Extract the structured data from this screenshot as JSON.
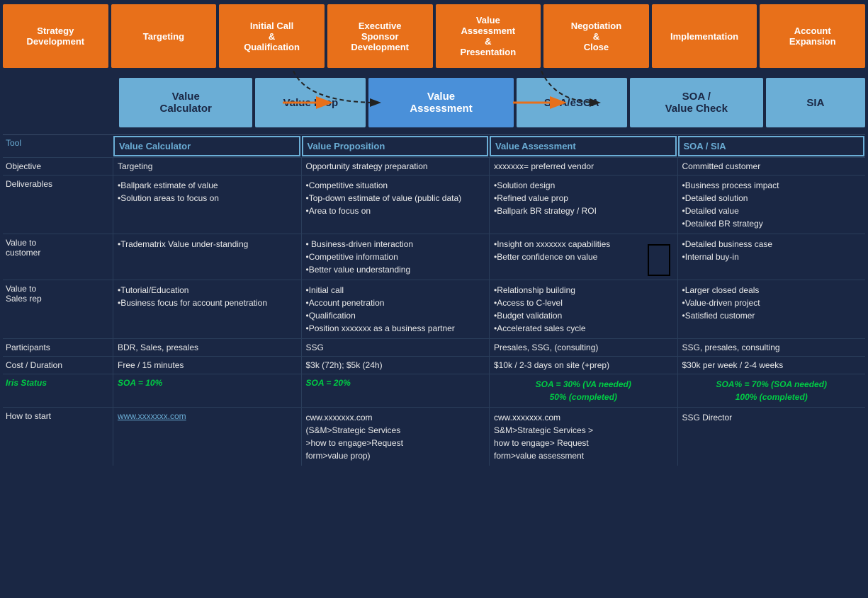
{
  "stages": [
    {
      "id": "strategy",
      "label": "Strategy\nDevelopment"
    },
    {
      "id": "targeting",
      "label": "Targeting"
    },
    {
      "id": "initial-call",
      "label": "Initial Call\n&\nQualification"
    },
    {
      "id": "exec-sponsor",
      "label": "Executive\nSponsor\nDevelopment"
    },
    {
      "id": "value-assess",
      "label": "Value\nAssessment\n&\nPresentation"
    },
    {
      "id": "negotiation",
      "label": "Negotiation\n&\nClose"
    },
    {
      "id": "implementation",
      "label": "Implementation"
    },
    {
      "id": "account-exp",
      "label": "Account\nExpansion"
    }
  ],
  "tools": [
    {
      "id": "value-calc",
      "label": "Value\nCalculator"
    },
    {
      "id": "value-prop",
      "label": "Value Prop"
    },
    {
      "id": "value-assessment",
      "label": "Value\nAssessment"
    },
    {
      "id": "soa-esoa",
      "label": "SOA/eSOA"
    },
    {
      "id": "soa-value-check",
      "label": "SOA /\nValue Check"
    },
    {
      "id": "sia",
      "label": "SIA"
    }
  ],
  "tool_label": "Tool",
  "rows": [
    {
      "id": "tool-header",
      "label": "Tool",
      "label_class": "tool-label",
      "cells": [
        "Value Calculator",
        "Value Proposition",
        "Value Assessment",
        "SOA / SIA"
      ]
    },
    {
      "id": "objective",
      "label": "Objective",
      "cells": [
        "Targeting",
        "Opportunity strategy preparation",
        "xxxxxxx= preferred vendor",
        "Committed customer"
      ]
    },
    {
      "id": "deliverables",
      "label": "Deliverables",
      "cells": [
        "•Ballpark estimate of value\n•Solution areas to focus on",
        "•Competitive situation\n•Top-down estimate of value (public data)\n•Area to focus on",
        "•Solution design\n•Refined value prop\n•Ballpark BR strategy / ROI",
        "•Business process impact\n•Detailed solution\n•Detailed value\n•Detailed BR strategy"
      ]
    },
    {
      "id": "value-customer",
      "label": "Value to\n customer",
      "cells": [
        "•Tradematrix Value under-standing",
        "• Business-driven interaction\n•Competitive information\n•Better value understanding",
        "•Insight on xxxxxxx capabilities\n•Better confidence on value",
        "•Detailed business case\n•Internal buy-in"
      ]
    },
    {
      "id": "value-salesrep",
      "label": "Value to\nSales rep",
      "cells": [
        "•Tutorial/Education\n•Business focus for account penetration",
        "•Initial call\n•Account penetration\n•Qualification\n•Position xxxxxxx as a business partner",
        "•Relationship building\n•Access to C-level\n•Budget validation\n•Accelerated sales cycle",
        "•Larger closed deals\n•Value-driven project\n•Satisfied customer"
      ]
    },
    {
      "id": "participants",
      "label": "Participants",
      "cells": [
        "BDR, Sales, presales",
        "SSG",
        "Presales, SSG, (consulting)",
        "SSG, presales, consulting"
      ]
    },
    {
      "id": "cost-duration",
      "label": "Cost / Duration",
      "cells": [
        "Free / 15 minutes",
        "$3k (72h);  $5k (24h)",
        "$10k / 2-3 days on site (+prep)",
        "$30k per week / 2-4 weeks"
      ]
    },
    {
      "id": "iris-status",
      "label": "Iris Status",
      "label_class": "iris",
      "cells": [
        "SOA = 10%",
        "SOA = 20%",
        "SOA = 30% (VA needed)\n50% (completed)",
        "SOA% = 70% (SOA needed)\n100% (completed)"
      ],
      "cells_class": "iris"
    },
    {
      "id": "how-to-start",
      "label": "How to start",
      "cells": [
        "www.xxxxxxx.com",
        "cww.xxxxxxx.com\n(S&M>Strategic Services\n>how to engage>Request\nform>value prop)",
        "cww.xxxxxxx.com\nS&M>Strategic Services >\nhow to engage> Request\nform>value assessment",
        "SSG Director"
      ],
      "first_cell_class": "link"
    }
  ]
}
